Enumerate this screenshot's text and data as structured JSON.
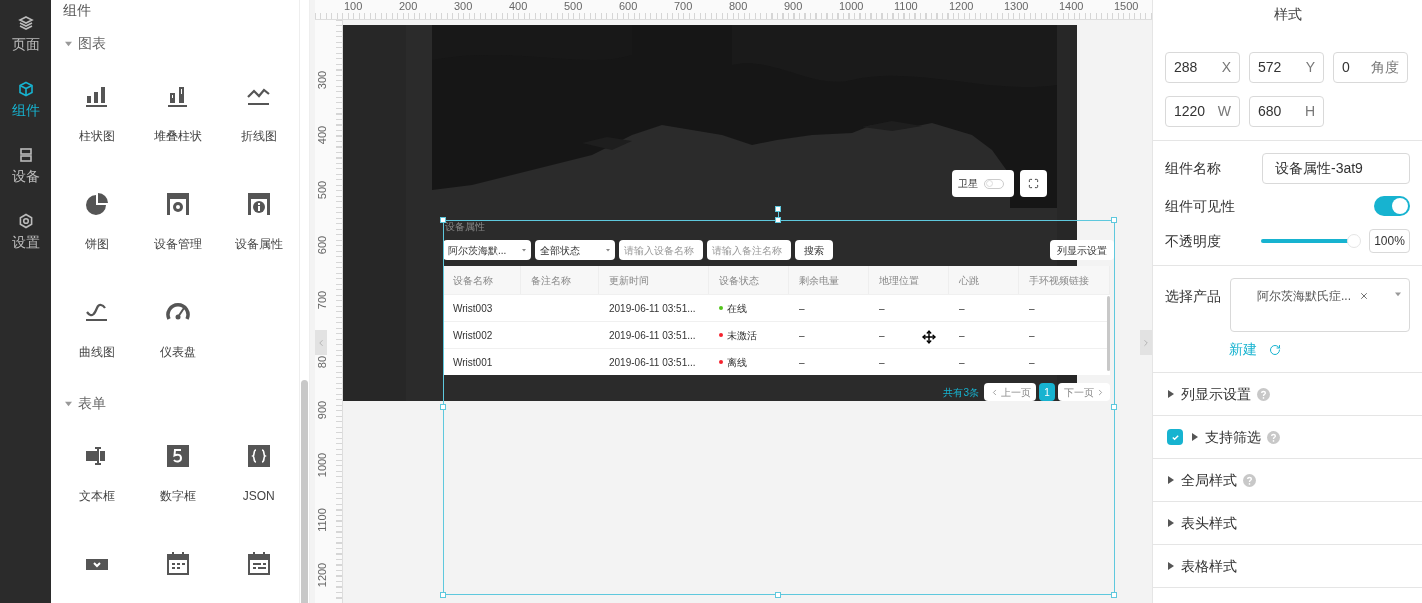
{
  "nav": [
    {
      "label": "页面",
      "selected": false
    },
    {
      "label": "组件",
      "selected": true
    },
    {
      "label": "设备",
      "selected": false
    },
    {
      "label": "设置",
      "selected": false
    }
  ],
  "component_panel": {
    "title": "组件",
    "sections": [
      {
        "title": "图表",
        "expanded": true,
        "items": [
          {
            "label": "柱状图"
          },
          {
            "label": "堆叠柱状"
          },
          {
            "label": "折线图"
          },
          {
            "label": "饼图"
          },
          {
            "label": "设备管理"
          },
          {
            "label": "设备属性"
          },
          {
            "label": "曲线图"
          },
          {
            "label": "仪表盘"
          }
        ]
      },
      {
        "title": "表单",
        "expanded": true,
        "items": [
          {
            "label": "文本框"
          },
          {
            "label": "数字框"
          },
          {
            "label": "JSON"
          }
        ]
      }
    ]
  },
  "rulers": {
    "horizontal": [
      "100",
      "200",
      "300",
      "400",
      "500",
      "600",
      "700",
      "800",
      "900",
      "1000",
      "1100",
      "1200",
      "1300",
      "1400",
      "1500"
    ],
    "vertical": [
      "300",
      "400",
      "500",
      "600",
      "700",
      "80",
      "900",
      "1000",
      "1100",
      "1200"
    ]
  },
  "canvas": {
    "map": {
      "kind": "picture",
      "layer_toggle": {
        "label": "卫星",
        "on": false
      }
    },
    "widget": {
      "title": "设备属性",
      "filters": {
        "product": "阿尔茨海默...",
        "status": "全部状态",
        "name_placeholder": "请输入设备名称",
        "remark_placeholder": "请输入备注名称",
        "search_button": "搜索",
        "columns_button": "列显示设置"
      },
      "table": {
        "columns": [
          "设备名称",
          "备注名称",
          "更新时间",
          "设备状态",
          "剩余电量",
          "地理位置",
          "心跳",
          "手环视频链接"
        ],
        "rows": [
          {
            "device_name": "Wrist003",
            "update_time": "2019-06-11 03:51...",
            "status": {
              "label": "在线",
              "color": "#52c41a"
            },
            "battery": "–",
            "location": "–",
            "heartbeat": "–",
            "video_link": "–"
          },
          {
            "device_name": "Wrist002",
            "update_time": "2019-06-11 03:51...",
            "status": {
              "label": "未激活",
              "color": "#f5222d"
            },
            "battery": "–",
            "location": "–",
            "heartbeat": "–",
            "video_link": "–"
          },
          {
            "device_name": "Wrist001",
            "update_time": "2019-06-11 03:51...",
            "status": {
              "label": "离线",
              "color": "#f5222d"
            },
            "battery": "–",
            "location": "–",
            "heartbeat": "–",
            "video_link": "–"
          }
        ]
      },
      "pagination": {
        "total": "共有3条",
        "prev": "上一页",
        "pages": [
          {
            "label": "1",
            "selected": true
          }
        ],
        "next": "下一页"
      }
    }
  },
  "inspector": {
    "title": "样式",
    "geometry": [
      {
        "value": "288",
        "unit": "X"
      },
      {
        "value": "572",
        "unit": "Y"
      },
      {
        "value": "0",
        "unit": "角度"
      },
      {
        "value": "1220",
        "unit": "W"
      },
      {
        "value": "680",
        "unit": "H"
      }
    ],
    "name": {
      "label": "组件名称",
      "value": "设备属性-3at9"
    },
    "visibility": {
      "label": "组件可见性",
      "on": true
    },
    "opacity": {
      "label": "不透明度",
      "level": 1,
      "value": "100%"
    },
    "product": {
      "label": "选择产品",
      "tag": "阿尔茨海默氏症...",
      "new_link": "新建"
    },
    "sections": [
      {
        "label": "列显示设置",
        "expanded": false,
        "help": true
      },
      {
        "label": "支持筛选",
        "expanded": false,
        "help": true,
        "checked": true
      },
      {
        "label": "全局样式",
        "expanded": false,
        "help": true
      },
      {
        "label": "表头样式",
        "expanded": false,
        "help": false
      },
      {
        "label": "表格样式",
        "expanded": false,
        "help": false
      }
    ]
  }
}
